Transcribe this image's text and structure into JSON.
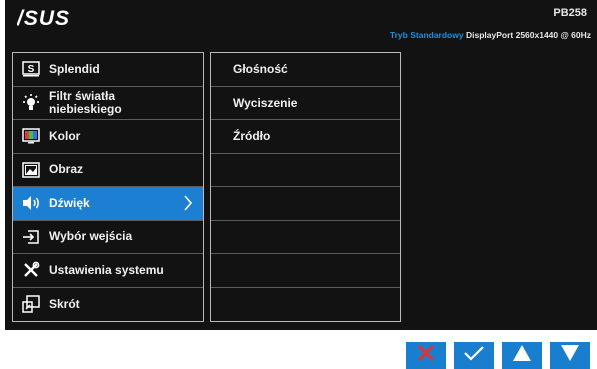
{
  "header": {
    "logo": "/SUS",
    "model": "PB258",
    "mode": "Tryb Standardowy",
    "port": "DisplayPort",
    "resolution": "2560x1440 @ 60Hz"
  },
  "menu": [
    {
      "label": "Splendid",
      "icon": "splendid-icon"
    },
    {
      "label": "Filtr światła\nniebieskiego",
      "icon": "blue-light-icon"
    },
    {
      "label": "Kolor",
      "icon": "color-icon"
    },
    {
      "label": "Obraz",
      "icon": "image-icon"
    },
    {
      "label": "Dźwięk",
      "icon": "speaker-icon",
      "selected": true
    },
    {
      "label": "Wybór wejścia",
      "icon": "input-select-icon"
    },
    {
      "label": "Ustawienia systemu",
      "icon": "wrench-icon"
    },
    {
      "label": "Skrót",
      "icon": "shortcut-icon"
    }
  ],
  "submenu": [
    "Głośność",
    "Wyciszenie",
    "Źródło",
    "",
    "",
    "",
    "",
    ""
  ],
  "buttons": [
    "close-icon",
    "check-icon",
    "up-arrow-icon",
    "down-arrow-icon"
  ],
  "colors": {
    "accent": "#1c7fd2",
    "background": "#121212",
    "mode_text": "#1a8fdc"
  }
}
